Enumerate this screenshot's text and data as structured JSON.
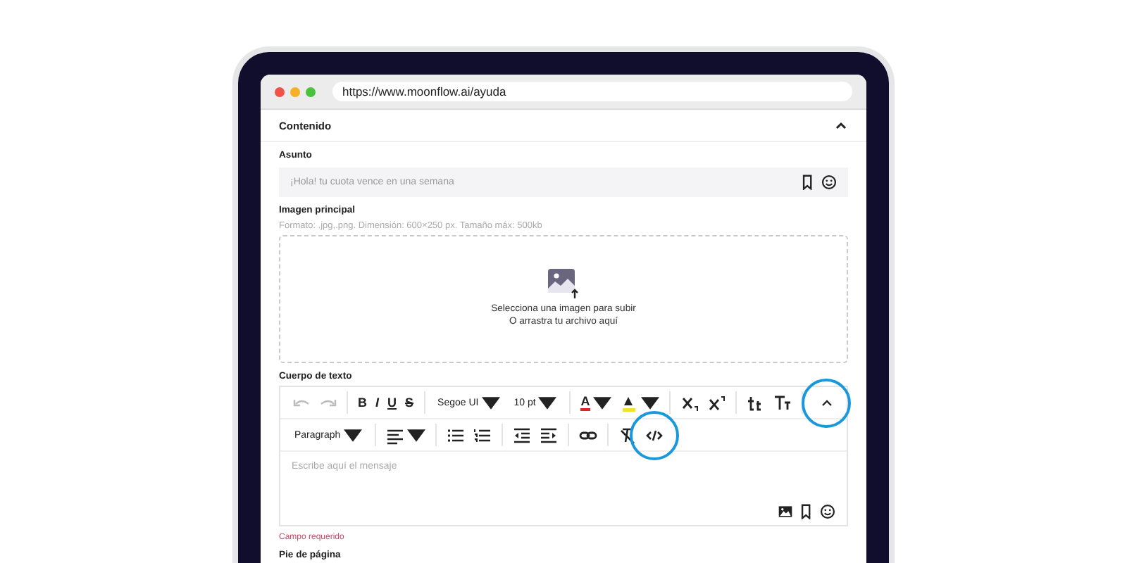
{
  "browser": {
    "url": "https://www.moonflow.ai/ayuda"
  },
  "section": {
    "title": "Contenido",
    "expanded": true
  },
  "subject": {
    "label": "Asunto",
    "placeholder": "¡Hola! tu cuota vence en una semana"
  },
  "image": {
    "label": "Imagen principal",
    "hint": "Formato: .jpg,.png. Dimensión: 600×250 px. Tamaño máx: 500kb",
    "line1": "Selecciona una imagen para subir",
    "line2": "O arrastra tu archivo aquí"
  },
  "body": {
    "label": "Cuerpo de texto",
    "placeholder": "Escribe aquí el mensaje",
    "error": "Campo requerido",
    "toolbar_rows": [
      [
        {
          "kind": "undo",
          "disabled": true
        },
        {
          "kind": "redo",
          "disabled": true
        },
        {
          "kind": "sep"
        },
        {
          "kind": "bold",
          "label": "B"
        },
        {
          "kind": "italic",
          "label": "I"
        },
        {
          "kind": "underline",
          "label": "U"
        },
        {
          "kind": "strike",
          "label": "S"
        },
        {
          "kind": "sep"
        },
        {
          "kind": "select",
          "label": "Segoe UI"
        },
        {
          "kind": "select",
          "label": "10 pt"
        },
        {
          "kind": "sep"
        },
        {
          "kind": "color",
          "label": "A",
          "color": "#e02424"
        },
        {
          "kind": "highlight",
          "color": "#f2e22b"
        },
        {
          "kind": "sep"
        },
        {
          "kind": "sub"
        },
        {
          "kind": "sup"
        },
        {
          "kind": "sep"
        },
        {
          "kind": "grow"
        },
        {
          "kind": "shrink"
        },
        {
          "kind": "sep"
        },
        {
          "kind": "spacer"
        },
        {
          "kind": "collapse",
          "highlighted": true
        }
      ],
      [
        {
          "kind": "select",
          "label": "Paragraph"
        },
        {
          "kind": "sep"
        },
        {
          "kind": "align"
        },
        {
          "kind": "sep"
        },
        {
          "kind": "bullets"
        },
        {
          "kind": "numbers"
        },
        {
          "kind": "sep"
        },
        {
          "kind": "outdent"
        },
        {
          "kind": "indent"
        },
        {
          "kind": "sep"
        },
        {
          "kind": "link"
        },
        {
          "kind": "sep"
        },
        {
          "kind": "clear"
        },
        {
          "kind": "code",
          "highlighted": true
        }
      ]
    ]
  },
  "footer": {
    "label": "Pie de página"
  }
}
